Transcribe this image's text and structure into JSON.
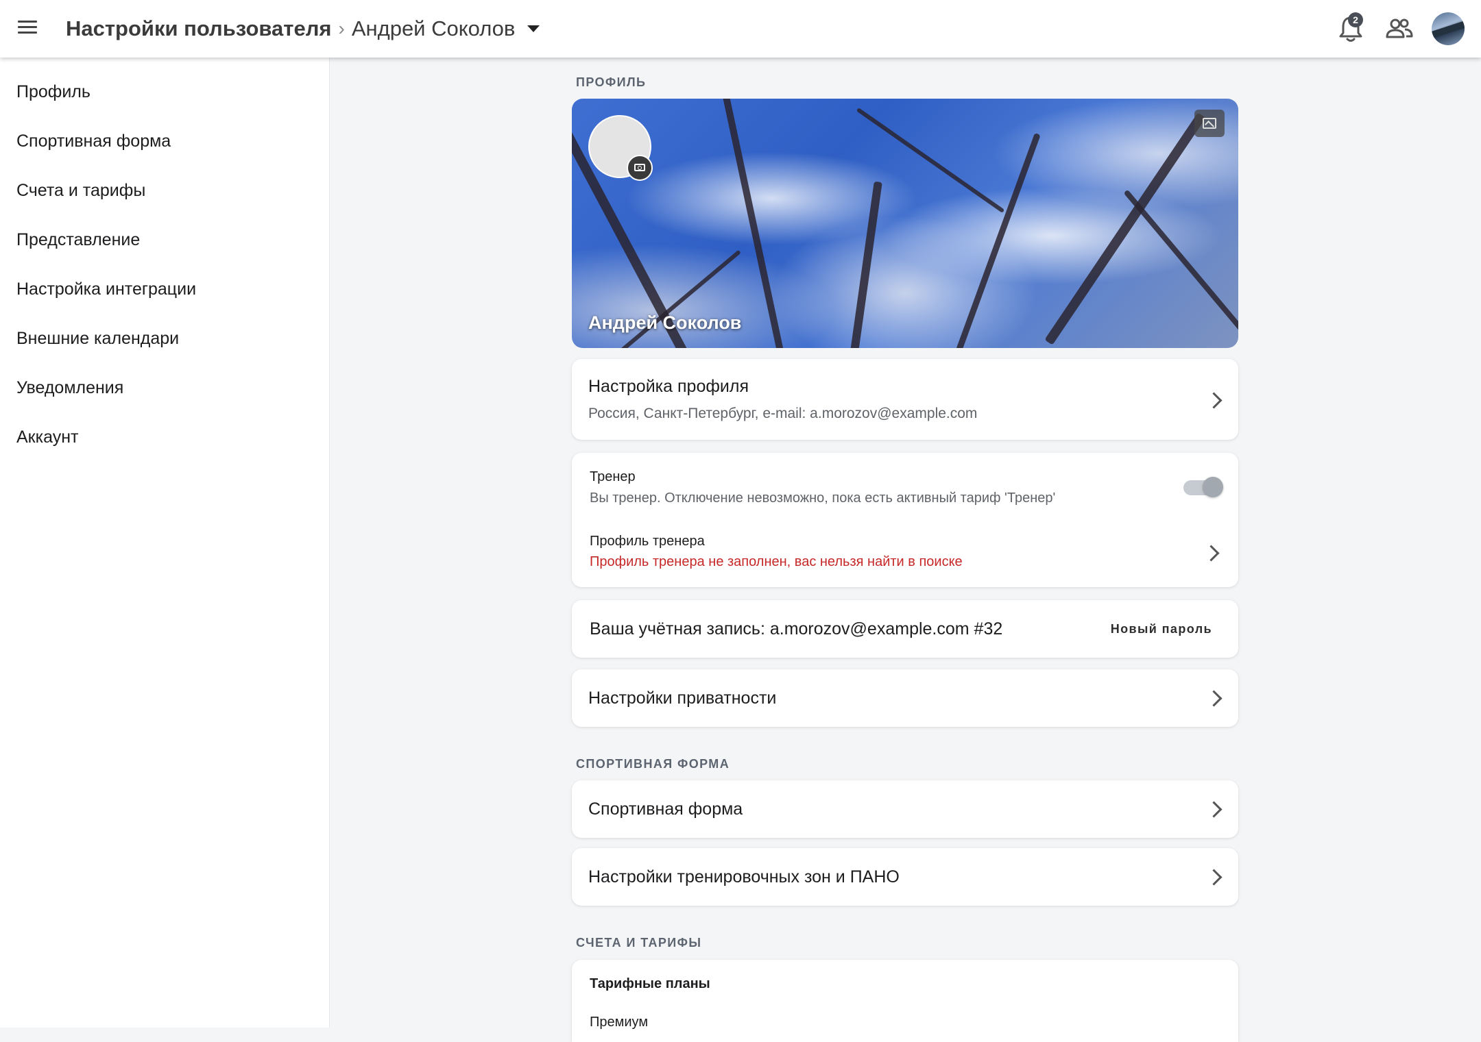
{
  "header": {
    "breadcrumb_root": "Настройки пользователя",
    "breadcrumb_separator": "›",
    "breadcrumb_user": "Андрей Соколов",
    "notifications_count": "2"
  },
  "sidebar": {
    "items": [
      {
        "label": "Профиль"
      },
      {
        "label": "Спортивная форма"
      },
      {
        "label": "Счета и тарифы"
      },
      {
        "label": "Представление"
      },
      {
        "label": "Настройка интеграции"
      },
      {
        "label": "Внешние календари"
      },
      {
        "label": "Уведомления"
      },
      {
        "label": "Аккаунт"
      }
    ]
  },
  "profile_section": {
    "title": "ПРОФИЛЬ",
    "cover_name": "Андрей Соколов",
    "profile_settings": {
      "title": "Настройка профиля",
      "subtitle": "Россия, Санкт-Петербург, e-mail: a.morozov@example.com"
    },
    "coach": {
      "title": "Тренер",
      "subtitle": "Вы тренер. Отключение невозможно, пока есть активный тариф 'Тренер'",
      "toggle_on": true
    },
    "coach_profile": {
      "title": "Профиль тренера",
      "subtitle": "Профиль тренера не заполнен, вас нельзя найти в поиске",
      "status_color": "#c62828"
    },
    "account": {
      "text": "Ваша учётная запись: a.morozov@example.com #32",
      "new_password_label": "Новый пароль"
    },
    "privacy": {
      "title": "Настройки приватности"
    }
  },
  "fitness_section": {
    "title": "СПОРТИВНАЯ ФОРМА",
    "items": [
      {
        "title": "Спортивная форма"
      },
      {
        "title": "Настройки тренировочных зон и ПАНО"
      }
    ]
  },
  "billing_section": {
    "title": "СЧЕТА И ТАРИФЫ",
    "plans_title": "Тарифные планы",
    "plan_first": "Премиум"
  }
}
